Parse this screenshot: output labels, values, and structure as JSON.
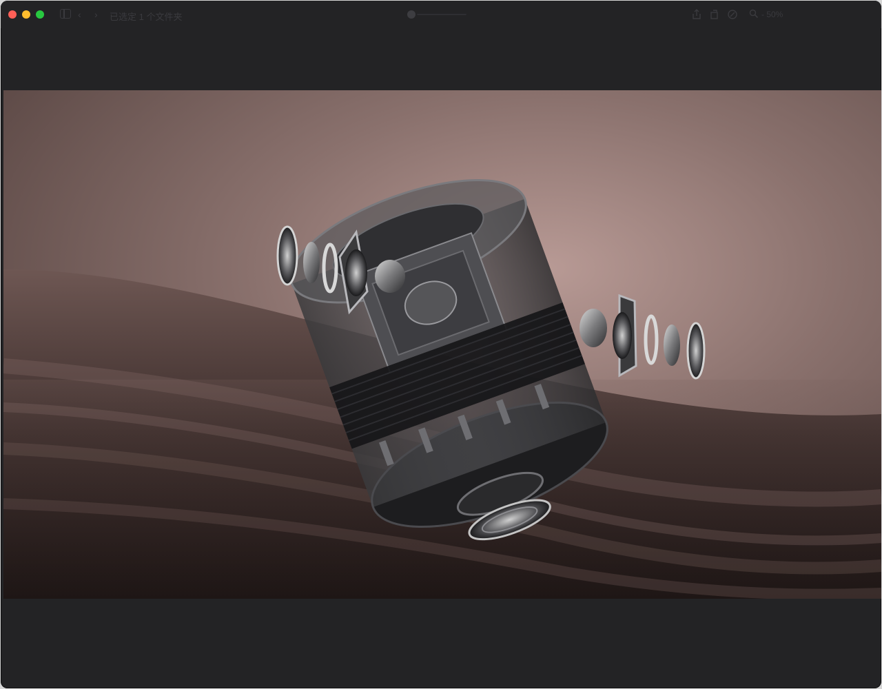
{
  "window": {
    "title": "已选定 1 个文件夹",
    "zoom_label": "- 50%",
    "colors": {
      "background": "#232325",
      "photo_top": "#a88a86",
      "photo_bottom": "#2a1f1e",
      "close": "#fe5f57",
      "minimize": "#febc2e",
      "maximize": "#28c840"
    }
  },
  "toolbar": {
    "icons": [
      "sidebar-icon",
      "back-icon",
      "forward-icon",
      "scrubber",
      "share-icon",
      "rotate-icon",
      "markup-icon",
      "zoom-icon"
    ]
  },
  "viewer": {
    "image_subject": "exploded smart speaker render"
  }
}
